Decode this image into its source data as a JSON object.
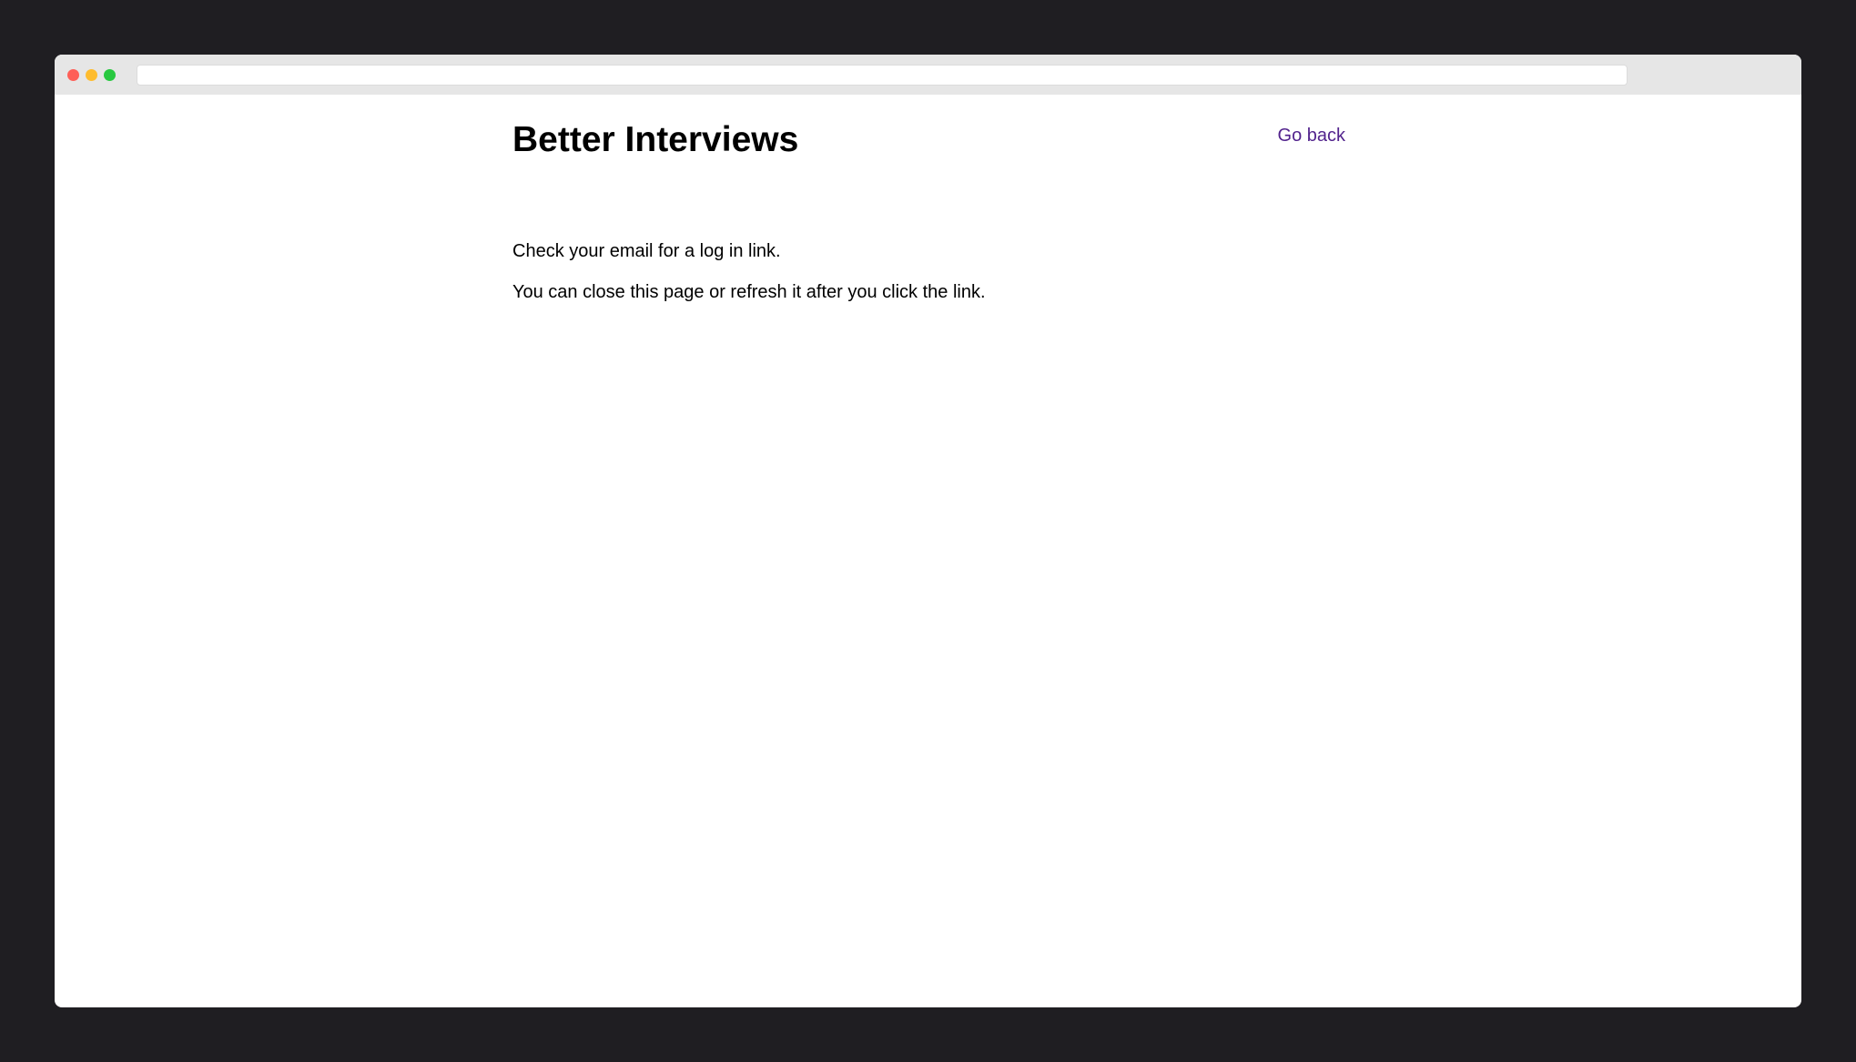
{
  "window": {
    "controls": {
      "close_color": "#fe5f57",
      "minimize_color": "#febc2e",
      "maximize_color": "#28c840"
    },
    "address_bar_value": ""
  },
  "page": {
    "title": "Better Interviews",
    "go_back_label": "Go back",
    "link_color": "#52238d",
    "messages": [
      "Check your email for a log in link.",
      "You can close this page or refresh it after you click the link."
    ]
  }
}
